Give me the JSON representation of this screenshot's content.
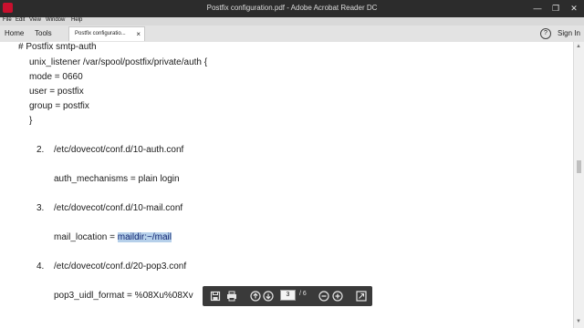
{
  "window": {
    "title": "Postfix configuration.pdf - Adobe Acrobat Reader DC",
    "minimize": "—",
    "maximize": "❐",
    "close": "✕"
  },
  "menu": [
    "File",
    "Edit",
    "View",
    "Window",
    "Help"
  ],
  "tabs": {
    "home": "Home",
    "tools": "Tools",
    "document": "Postfix configuratio...",
    "close": "×",
    "help": "?",
    "sign_in": "Sign In"
  },
  "document": {
    "lines": [
      "# Postfix smtp-auth",
      "unix_listener /var/spool/postfix/private/auth {",
      "mode = 0660",
      "user = postfix",
      "group = postfix",
      "}",
      "2.",
      "/etc/dovecot/conf.d/10-auth.conf",
      "auth_mechanisms = plain login",
      "3.",
      "/etc/dovecot/conf.d/10-mail.conf",
      "mail_location = ",
      "maildir:~/mail",
      "4.",
      "/etc/dovecot/conf.d/20-pop3.conf",
      "pop3_uidl_format = %08Xu%08Xv"
    ]
  },
  "toolbar": {
    "current_page": "3",
    "total_pages": "/ 6"
  },
  "colors": {
    "titlebar": "#2c2c2c",
    "highlight": "#b6d0ea",
    "floating_toolbar": "#3a3a3a"
  }
}
